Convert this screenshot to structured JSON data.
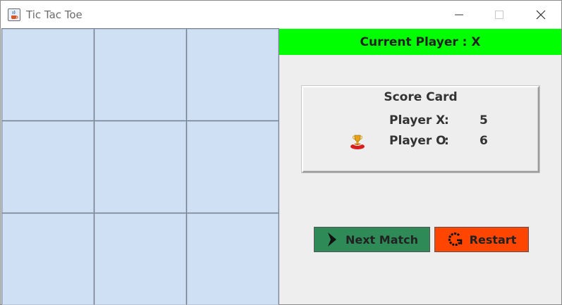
{
  "window": {
    "title": "Tic Tac Toe",
    "app_icon": "java-cup-icon",
    "controls": [
      "minimize-icon",
      "maximize-icon",
      "close-icon"
    ]
  },
  "board": {
    "cells": [
      "",
      "",
      "",
      "",
      "",
      "",
      "",
      "",
      ""
    ],
    "cell_color": "#cfdff4",
    "grid_color": "#6f7f90"
  },
  "status": {
    "current_player": "Current Player : X",
    "bar_color": "#00ff00"
  },
  "score_card": {
    "title": "Score Card",
    "rows": [
      {
        "label": "Player X",
        "colon": ":",
        "value": "5",
        "leader": false
      },
      {
        "label": "Player O",
        "colon": ":",
        "value": "6",
        "leader": true
      }
    ],
    "leader_icon": "trophy-icon"
  },
  "buttons": {
    "next_match": {
      "label": "Next Match",
      "icon": "play-arrow-icon",
      "color": "#2e8b57"
    },
    "restart": {
      "label": "Restart",
      "icon": "restart-icon",
      "color": "#ff4500"
    }
  }
}
